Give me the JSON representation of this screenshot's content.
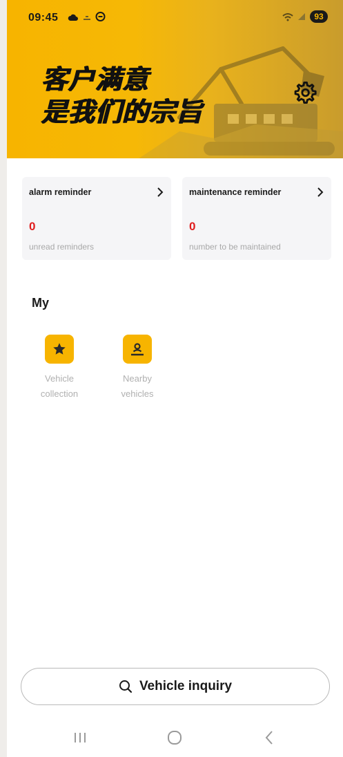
{
  "status_bar": {
    "time": "09:45",
    "battery": "93",
    "left_icons": [
      "cloud-icon",
      "signal-small-icon",
      "message-icon"
    ],
    "right_icons": [
      "wifi-icon",
      "cellular-icon",
      "battery-icon"
    ]
  },
  "hero": {
    "slogan_line1": "客户满意",
    "slogan_line2": "是我们的宗旨",
    "settings_icon": "gear-icon",
    "background_color": "#f7b400"
  },
  "cards": {
    "alarm": {
      "title": "alarm reminder",
      "count": "0",
      "subtitle": "unread reminders"
    },
    "maintenance": {
      "title": "maintenance reminder",
      "count": "0",
      "subtitle": "number to be maintained"
    }
  },
  "my": {
    "title": "My",
    "items": [
      {
        "label_line1": "Vehicle",
        "label_line2": "collection",
        "icon": "star-icon"
      },
      {
        "label_line1": "Nearby",
        "label_line2": "vehicles",
        "icon": "person-location-icon"
      }
    ]
  },
  "search": {
    "label": "Vehicle inquiry",
    "icon": "search-icon"
  },
  "navbar": {
    "icons": [
      "recents-icon",
      "home-icon",
      "back-icon"
    ]
  },
  "colors": {
    "accent": "#f7b400",
    "count": "#e01e1e",
    "muted": "#a8a8a8"
  }
}
